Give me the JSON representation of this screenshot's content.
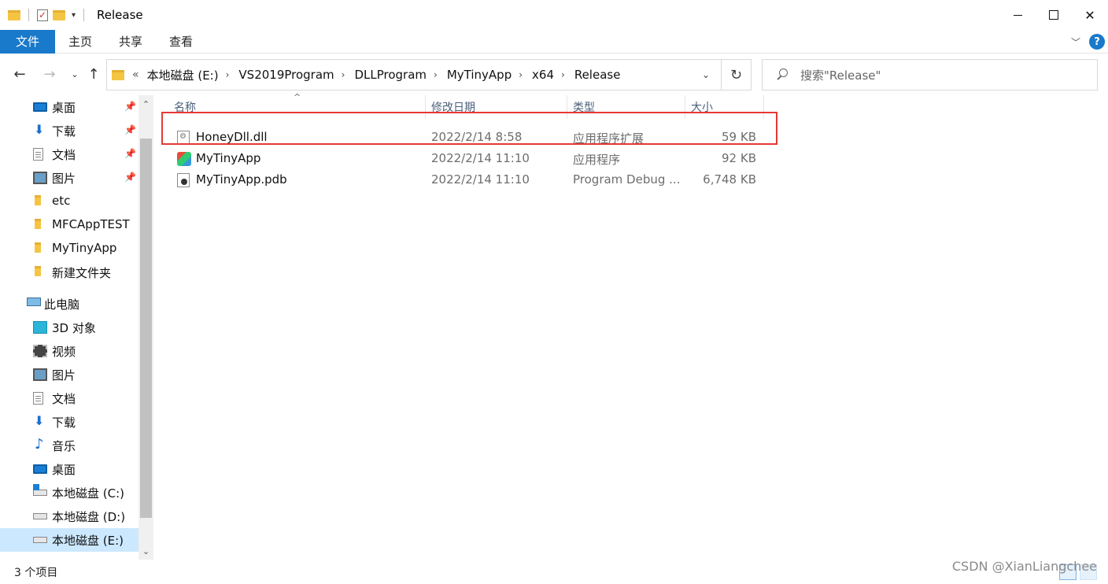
{
  "window": {
    "title": "Release"
  },
  "ribbon": {
    "tabs": [
      "文件",
      "主页",
      "共享",
      "查看"
    ],
    "help_label": "?"
  },
  "address": {
    "overflow": "«",
    "crumbs": [
      "本地磁盘 (E:)",
      "VS2019Program",
      "DLLProgram",
      "MyTinyApp",
      "x64",
      "Release"
    ]
  },
  "search": {
    "placeholder": "搜索\"Release\""
  },
  "nav": {
    "quick_access": [
      {
        "label": "桌面",
        "icon": "desktop-icon",
        "pinned": true
      },
      {
        "label": "下载",
        "icon": "download-icon",
        "pinned": true
      },
      {
        "label": "文档",
        "icon": "document-icon",
        "pinned": true
      },
      {
        "label": "图片",
        "icon": "pictures-icon",
        "pinned": true
      },
      {
        "label": "etc",
        "icon": "folder-icon",
        "pinned": false
      },
      {
        "label": "MFCAppTEST",
        "icon": "folder-icon",
        "pinned": false
      },
      {
        "label": "MyTinyApp",
        "icon": "folder-icon",
        "pinned": false
      },
      {
        "label": "新建文件夹",
        "icon": "folder-icon",
        "pinned": false
      }
    ],
    "this_pc": {
      "label": "此电脑",
      "items": [
        {
          "label": "3D 对象",
          "icon": "3d-objects-icon"
        },
        {
          "label": "视频",
          "icon": "video-icon"
        },
        {
          "label": "图片",
          "icon": "pictures-icon"
        },
        {
          "label": "文档",
          "icon": "document-icon"
        },
        {
          "label": "下载",
          "icon": "download-icon"
        },
        {
          "label": "音乐",
          "icon": "music-icon"
        },
        {
          "label": "桌面",
          "icon": "desktop-icon"
        },
        {
          "label": "本地磁盘 (C:)",
          "icon": "system-drive-icon"
        },
        {
          "label": "本地磁盘 (D:)",
          "icon": "drive-icon"
        },
        {
          "label": "本地磁盘 (E:)",
          "icon": "drive-icon",
          "selected": true
        }
      ]
    }
  },
  "files": {
    "columns": {
      "name": "名称",
      "date": "修改日期",
      "type": "类型",
      "size": "大小"
    },
    "rows": [
      {
        "name": "HoneyDll.dll",
        "date": "2022/2/14 8:58",
        "type": "应用程序扩展",
        "size": "59 KB",
        "icon": "dll-file-icon"
      },
      {
        "name": "MyTinyApp",
        "date": "2022/2/14 11:10",
        "type": "应用程序",
        "size": "92 KB",
        "icon": "exe-file-icon"
      },
      {
        "name": "MyTinyApp.pdb",
        "date": "2022/2/14 11:10",
        "type": "Program Debug ...",
        "size": "6,748 KB",
        "icon": "pdb-file-icon"
      }
    ]
  },
  "status": {
    "count": "3 个项目"
  },
  "watermark": "CSDN @XianLiangchee",
  "colors": {
    "accent": "#1979ca",
    "selection": "#cce8ff",
    "highlight_box": "#e53935"
  }
}
